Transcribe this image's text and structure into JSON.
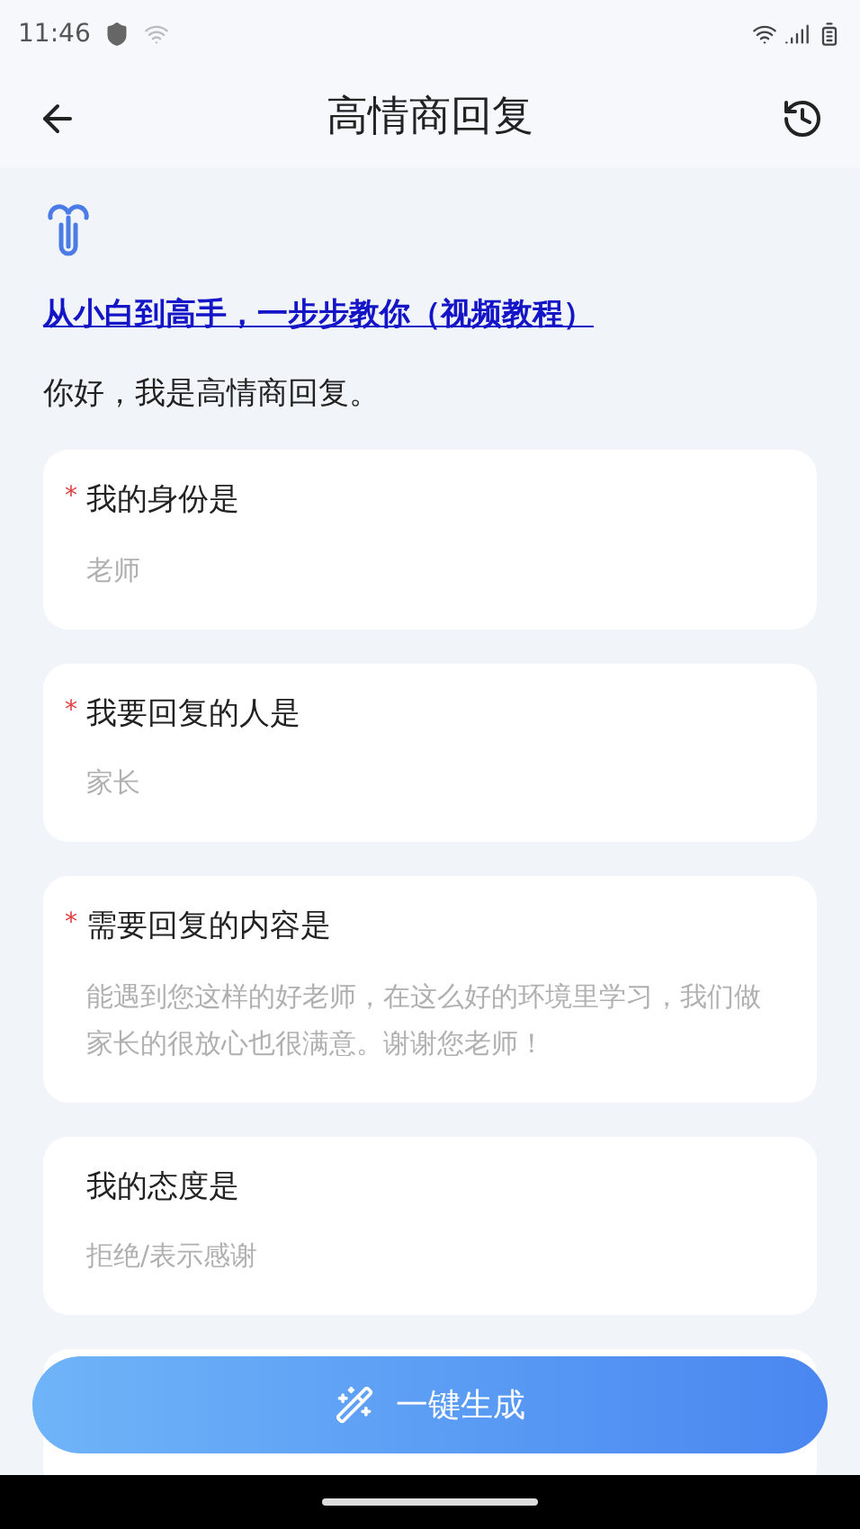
{
  "status_bar": {
    "time": "11:46"
  },
  "header": {
    "title": "高情商回复"
  },
  "tutorial_link": "从小白到高手，一步步教你（视频教程）",
  "greeting": "你好，我是高情商回复。",
  "fields": [
    {
      "label": "我的身份是",
      "required": true,
      "placeholder": "老师"
    },
    {
      "label": "我要回复的人是",
      "required": true,
      "placeholder": "家长"
    },
    {
      "label": "需要回复的内容是",
      "required": true,
      "placeholder": "能遇到您这样的好老师，在这么好的环境里学习，我们做家长的很放心也很满意。谢谢您老师！"
    },
    {
      "label": "我的态度是",
      "required": false,
      "placeholder": "拒绝/表示感谢"
    }
  ],
  "required_mark": "*",
  "generate_button": "一键生成"
}
